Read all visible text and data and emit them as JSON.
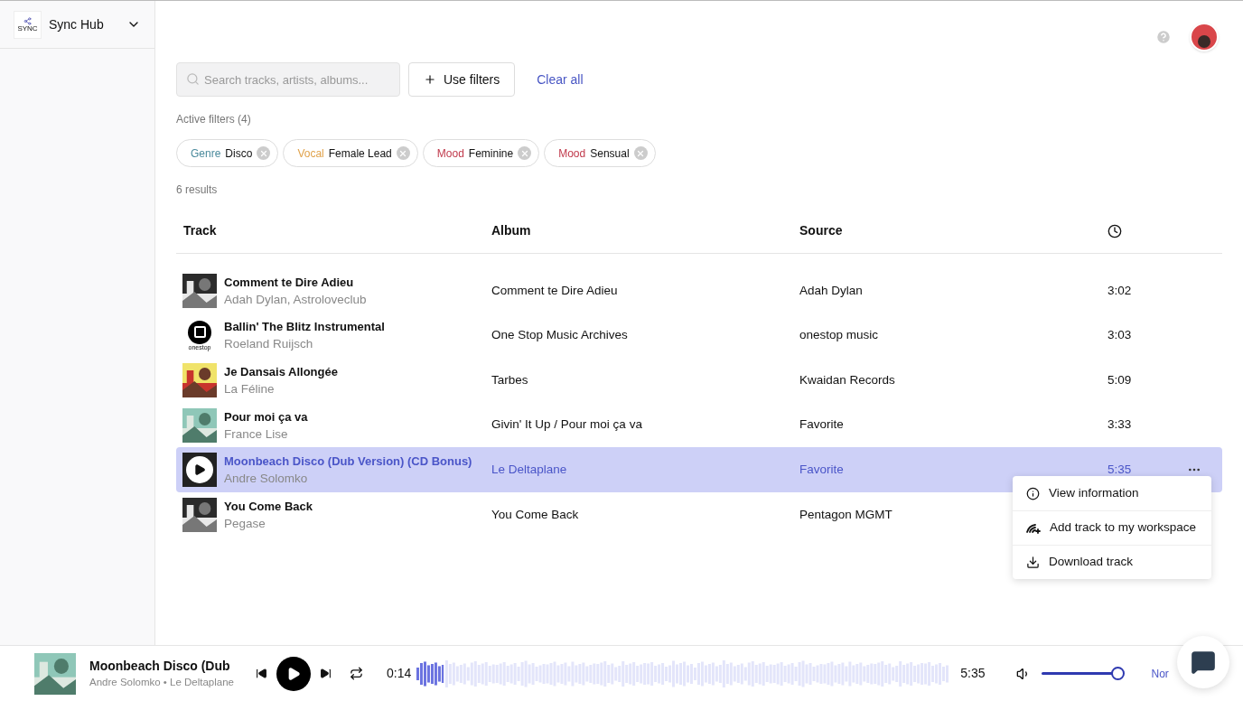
{
  "workspace": {
    "logo_text": "SYNC",
    "name": "Sync Hub"
  },
  "search": {
    "placeholder": "Search tracks, artists, albums..."
  },
  "use_filters_button": "Use filters",
  "clear_all_link": "Clear all",
  "active_filters_label": "Active filters (4)",
  "filters": [
    {
      "category": "Genre",
      "value": "Disco",
      "color": "#4a8a9c"
    },
    {
      "category": "Vocal",
      "value": "Female Lead",
      "color": "#e0a24a"
    },
    {
      "category": "Mood",
      "value": "Feminine",
      "color": "#c0394b"
    },
    {
      "category": "Mood",
      "value": "Sensual",
      "color": "#c0394b"
    }
  ],
  "results_count": "6 results",
  "table": {
    "columns": [
      "Track",
      "Album",
      "Source"
    ],
    "rows": [
      {
        "title": "Comment te Dire Adieu",
        "artist": "Adah Dylan, Astroloveclub",
        "album": "Comment te Dire Adieu",
        "source": "Adah Dylan",
        "duration": "3:02",
        "selected": false,
        "kind": "picture"
      },
      {
        "title": "Ballin' The Blitz Instrumental",
        "artist": "Roeland Ruijsch",
        "album": "One Stop Music Archives",
        "source": "onestop music",
        "duration": "3:03",
        "selected": false,
        "kind": "logo",
        "cover_text": "onestop"
      },
      {
        "title": "Je Dansais Allongée",
        "artist": "La Féline",
        "album": "Tarbes",
        "source": "Kwaidan Records",
        "duration": "5:09",
        "selected": false,
        "kind": "picture"
      },
      {
        "title": "Pour moi ça va",
        "artist": "France Lise",
        "album": "Givin' It Up / Pour moi ça va",
        "source": "Favorite",
        "duration": "3:33",
        "selected": false,
        "kind": "picture"
      },
      {
        "title": "Moonbeach Disco (Dub Version) (CD Bonus)",
        "artist": "Andre Solomko",
        "album": "Le Deltaplane",
        "source": "Favorite",
        "duration": "5:35",
        "selected": true,
        "kind": "play"
      },
      {
        "title": "You Come Back",
        "artist": "Pegase",
        "album": "You Come Back",
        "source": "Pentagon MGMT",
        "selected": false,
        "kind": "picture"
      }
    ]
  },
  "context_menu": [
    {
      "kind": "info",
      "label": "View information"
    },
    {
      "kind": "workspace",
      "label": "Add track to my workspace"
    },
    {
      "kind": "download",
      "label": "Download track"
    }
  ],
  "player": {
    "title": "Moonbeach Disco (Dub",
    "subtitle": "Andre Solomko • Le Deltaplane",
    "elapsed": "0:14",
    "total": "5:35",
    "level": 0.05,
    "volume": {
      "level": 0.93
    },
    "speed": "Nor"
  }
}
